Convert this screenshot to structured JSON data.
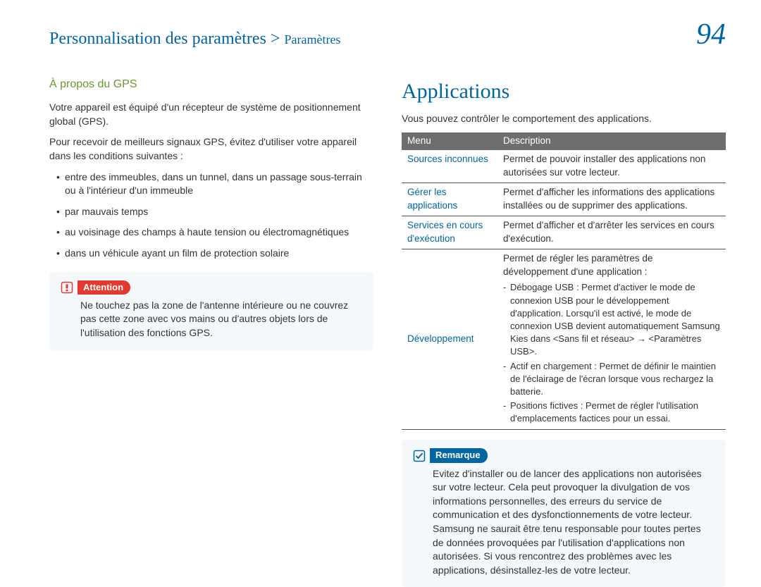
{
  "header": {
    "breadcrumb_main": "Personnalisation des paramètres",
    "breadcrumb_separator": " > ",
    "breadcrumb_sub": "Paramètres",
    "page_number": "94"
  },
  "left": {
    "heading": "À propos du GPS",
    "p1": "Votre appareil est équipé d'un récepteur de système de positionnement global (GPS).",
    "p2": "Pour recevoir de meilleurs signaux GPS, évitez d'utiliser votre appareil dans les conditions suivantes :",
    "bullets": {
      "0": "entre des immeubles, dans un tunnel, dans un passage sous-terrain ou à l'intérieur d'un immeuble",
      "1": "par mauvais temps",
      "2": "au voisinage des champs à haute tension ou électromagnétiques",
      "3": "dans un véhicule ayant un film de protection solaire"
    },
    "attention": {
      "label": "Attention",
      "text": "Ne touchez pas la zone de l'antenne intérieure ou ne couvrez pas cette zone avec vos mains ou d'autres objets lors de l'utilisation des fonctions GPS."
    }
  },
  "right": {
    "heading": "Applications",
    "intro": "Vous pouvez contrôler le comportement des applications.",
    "table": {
      "col_menu": "Menu",
      "col_desc": "Description",
      "rows": {
        "0": {
          "menu": "Sources inconnues",
          "desc": "Permet de pouvoir installer des applications non autorisées sur votre lecteur."
        },
        "1": {
          "menu": "Gérer les applications",
          "desc": "Permet d'afficher les informations des applications installées ou de supprimer des applications."
        },
        "2": {
          "menu": "Services en cours d'exécution",
          "desc": "Permet d'afficher et d'arrêter les services en cours d'exécution."
        },
        "3": {
          "menu": "Développement",
          "desc_intro": "Permet de régler les paramètres de développement d'une application :",
          "items": {
            "0": "Débogage USB : Permet d'activer le mode de connexion USB pour le développement d'application. Lorsqu'il est activé, le mode de connexion USB devient automatiquement Samsung Kies dans <Sans fil et réseau> → <Paramètres USB>.",
            "1": "Actif en chargement : Permet de définir le maintien de l'éclairage de l'écran lorsque vous rechargez la batterie.",
            "2": "Positions fictives : Permet de régler l'utilisation d'emplacements factices pour un essai."
          }
        }
      }
    },
    "remark": {
      "label": "Remarque",
      "text": "Evitez d'installer ou de lancer des applications non autorisées sur votre lecteur. Cela peut provoquer la divulgation de vos informations personnelles, des erreurs du service de communication et des dysfonctionnements de votre lecteur. Samsung ne saurait être tenu responsable pour toutes pertes de données provoquées par l'utilisation d'applications non autorisées. Si vous rencontrez des problèmes avec les applications, désinstallez-les de votre lecteur."
    }
  }
}
